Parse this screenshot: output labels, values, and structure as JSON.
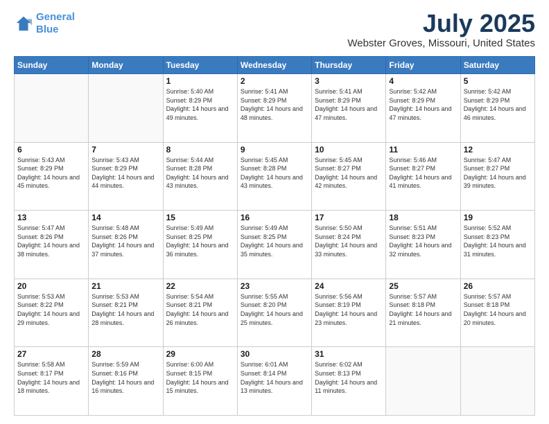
{
  "header": {
    "logo_line1": "General",
    "logo_line2": "Blue",
    "month": "July 2025",
    "location": "Webster Groves, Missouri, United States"
  },
  "days_of_week": [
    "Sunday",
    "Monday",
    "Tuesday",
    "Wednesday",
    "Thursday",
    "Friday",
    "Saturday"
  ],
  "weeks": [
    [
      {
        "day": "",
        "sunrise": "",
        "sunset": "",
        "daylight": ""
      },
      {
        "day": "",
        "sunrise": "",
        "sunset": "",
        "daylight": ""
      },
      {
        "day": "1",
        "sunrise": "Sunrise: 5:40 AM",
        "sunset": "Sunset: 8:29 PM",
        "daylight": "Daylight: 14 hours and 49 minutes."
      },
      {
        "day": "2",
        "sunrise": "Sunrise: 5:41 AM",
        "sunset": "Sunset: 8:29 PM",
        "daylight": "Daylight: 14 hours and 48 minutes."
      },
      {
        "day": "3",
        "sunrise": "Sunrise: 5:41 AM",
        "sunset": "Sunset: 8:29 PM",
        "daylight": "Daylight: 14 hours and 47 minutes."
      },
      {
        "day": "4",
        "sunrise": "Sunrise: 5:42 AM",
        "sunset": "Sunset: 8:29 PM",
        "daylight": "Daylight: 14 hours and 47 minutes."
      },
      {
        "day": "5",
        "sunrise": "Sunrise: 5:42 AM",
        "sunset": "Sunset: 8:29 PM",
        "daylight": "Daylight: 14 hours and 46 minutes."
      }
    ],
    [
      {
        "day": "6",
        "sunrise": "Sunrise: 5:43 AM",
        "sunset": "Sunset: 8:29 PM",
        "daylight": "Daylight: 14 hours and 45 minutes."
      },
      {
        "day": "7",
        "sunrise": "Sunrise: 5:43 AM",
        "sunset": "Sunset: 8:29 PM",
        "daylight": "Daylight: 14 hours and 44 minutes."
      },
      {
        "day": "8",
        "sunrise": "Sunrise: 5:44 AM",
        "sunset": "Sunset: 8:28 PM",
        "daylight": "Daylight: 14 hours and 43 minutes."
      },
      {
        "day": "9",
        "sunrise": "Sunrise: 5:45 AM",
        "sunset": "Sunset: 8:28 PM",
        "daylight": "Daylight: 14 hours and 43 minutes."
      },
      {
        "day": "10",
        "sunrise": "Sunrise: 5:45 AM",
        "sunset": "Sunset: 8:27 PM",
        "daylight": "Daylight: 14 hours and 42 minutes."
      },
      {
        "day": "11",
        "sunrise": "Sunrise: 5:46 AM",
        "sunset": "Sunset: 8:27 PM",
        "daylight": "Daylight: 14 hours and 41 minutes."
      },
      {
        "day": "12",
        "sunrise": "Sunrise: 5:47 AM",
        "sunset": "Sunset: 8:27 PM",
        "daylight": "Daylight: 14 hours and 39 minutes."
      }
    ],
    [
      {
        "day": "13",
        "sunrise": "Sunrise: 5:47 AM",
        "sunset": "Sunset: 8:26 PM",
        "daylight": "Daylight: 14 hours and 38 minutes."
      },
      {
        "day": "14",
        "sunrise": "Sunrise: 5:48 AM",
        "sunset": "Sunset: 8:26 PM",
        "daylight": "Daylight: 14 hours and 37 minutes."
      },
      {
        "day": "15",
        "sunrise": "Sunrise: 5:49 AM",
        "sunset": "Sunset: 8:25 PM",
        "daylight": "Daylight: 14 hours and 36 minutes."
      },
      {
        "day": "16",
        "sunrise": "Sunrise: 5:49 AM",
        "sunset": "Sunset: 8:25 PM",
        "daylight": "Daylight: 14 hours and 35 minutes."
      },
      {
        "day": "17",
        "sunrise": "Sunrise: 5:50 AM",
        "sunset": "Sunset: 8:24 PM",
        "daylight": "Daylight: 14 hours and 33 minutes."
      },
      {
        "day": "18",
        "sunrise": "Sunrise: 5:51 AM",
        "sunset": "Sunset: 8:23 PM",
        "daylight": "Daylight: 14 hours and 32 minutes."
      },
      {
        "day": "19",
        "sunrise": "Sunrise: 5:52 AM",
        "sunset": "Sunset: 8:23 PM",
        "daylight": "Daylight: 14 hours and 31 minutes."
      }
    ],
    [
      {
        "day": "20",
        "sunrise": "Sunrise: 5:53 AM",
        "sunset": "Sunset: 8:22 PM",
        "daylight": "Daylight: 14 hours and 29 minutes."
      },
      {
        "day": "21",
        "sunrise": "Sunrise: 5:53 AM",
        "sunset": "Sunset: 8:21 PM",
        "daylight": "Daylight: 14 hours and 28 minutes."
      },
      {
        "day": "22",
        "sunrise": "Sunrise: 5:54 AM",
        "sunset": "Sunset: 8:21 PM",
        "daylight": "Daylight: 14 hours and 26 minutes."
      },
      {
        "day": "23",
        "sunrise": "Sunrise: 5:55 AM",
        "sunset": "Sunset: 8:20 PM",
        "daylight": "Daylight: 14 hours and 25 minutes."
      },
      {
        "day": "24",
        "sunrise": "Sunrise: 5:56 AM",
        "sunset": "Sunset: 8:19 PM",
        "daylight": "Daylight: 14 hours and 23 minutes."
      },
      {
        "day": "25",
        "sunrise": "Sunrise: 5:57 AM",
        "sunset": "Sunset: 8:18 PM",
        "daylight": "Daylight: 14 hours and 21 minutes."
      },
      {
        "day": "26",
        "sunrise": "Sunrise: 5:57 AM",
        "sunset": "Sunset: 8:18 PM",
        "daylight": "Daylight: 14 hours and 20 minutes."
      }
    ],
    [
      {
        "day": "27",
        "sunrise": "Sunrise: 5:58 AM",
        "sunset": "Sunset: 8:17 PM",
        "daylight": "Daylight: 14 hours and 18 minutes."
      },
      {
        "day": "28",
        "sunrise": "Sunrise: 5:59 AM",
        "sunset": "Sunset: 8:16 PM",
        "daylight": "Daylight: 14 hours and 16 minutes."
      },
      {
        "day": "29",
        "sunrise": "Sunrise: 6:00 AM",
        "sunset": "Sunset: 8:15 PM",
        "daylight": "Daylight: 14 hours and 15 minutes."
      },
      {
        "day": "30",
        "sunrise": "Sunrise: 6:01 AM",
        "sunset": "Sunset: 8:14 PM",
        "daylight": "Daylight: 14 hours and 13 minutes."
      },
      {
        "day": "31",
        "sunrise": "Sunrise: 6:02 AM",
        "sunset": "Sunset: 8:13 PM",
        "daylight": "Daylight: 14 hours and 11 minutes."
      },
      {
        "day": "",
        "sunrise": "",
        "sunset": "",
        "daylight": ""
      },
      {
        "day": "",
        "sunrise": "",
        "sunset": "",
        "daylight": ""
      }
    ]
  ]
}
